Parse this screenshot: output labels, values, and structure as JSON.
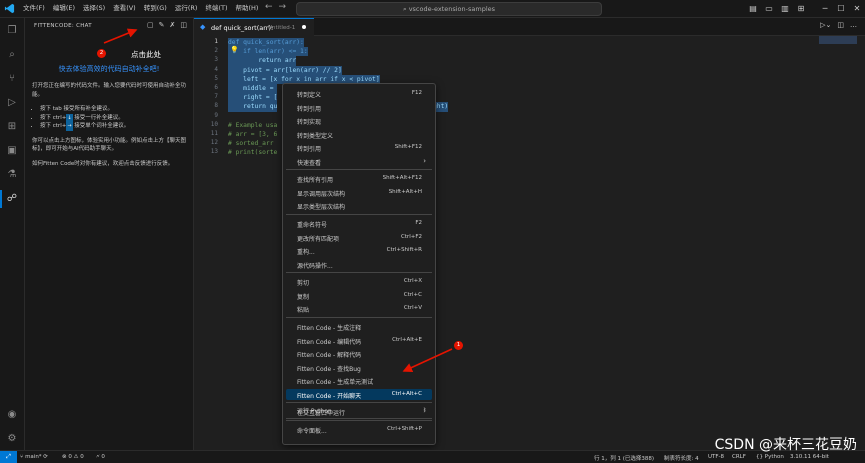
{
  "titlebar": {
    "menu": [
      "文件(F)",
      "编辑(E)",
      "选择(S)",
      "查看(V)",
      "转到(G)",
      "运行(R)",
      "终端(T)",
      "帮助(H)"
    ],
    "search": "vscode-extension-samples"
  },
  "sidebar": {
    "title": "FITTENCODE: CHAT",
    "callout": "点击此处",
    "promo": "快去体验高效的代码自动补全吧!",
    "intro": "打开您正在编写的代码文件。输入您要代码时可使用自动补全功能。",
    "tips": [
      "按下 tab 接受所有补全建议。",
      "按下 ctrl+",
      "接受一行补全建议。",
      "按下 ctrl+",
      "接受单个词补全建议。"
    ],
    "para2": "你可以点击上方图标，体验实用小功能。例如点击上方【聊天图标】，即可开始与AI代码助手聊天。",
    "para3": "如何Fitten Code时对你有建议，欢迎点击反馈进行反馈。"
  },
  "editor": {
    "tab_name": "def quick_sort(arr):",
    "tab_path": "Untitled-1",
    "code": {
      "l1": "def quick_sort(arr):",
      "l2": "    if len(arr) <= 1:",
      "l3": "        return arr",
      "l4": "    pivot = arr[len(arr) // 2]",
      "l5": "    left = [x for x in arr if x < pivot]",
      "l6": "    middle = ",
      "l7": "    right = [",
      "l8": "    return qu",
      "l8b": "ght)",
      "l10": "# Example usa",
      "l11": "# arr = [3, 6",
      "l12": "# sorted_arr ",
      "l13": "# print(sorte"
    }
  },
  "context_menu": {
    "items": [
      {
        "label": "转到定义",
        "shortcut": "F12"
      },
      {
        "label": "转到引用",
        "shortcut": ""
      },
      {
        "label": "转到实现",
        "shortcut": ""
      },
      {
        "label": "转到类型定义",
        "shortcut": ""
      },
      {
        "label": "转到引用",
        "shortcut": "Shift+F12"
      },
      {
        "label": "快速查看",
        "shortcut": ""
      },
      {
        "label": "查找所有引用",
        "shortcut": "Shift+Alt+F12"
      },
      {
        "label": "显示调用层次结构",
        "shortcut": "Shift+Alt+H"
      },
      {
        "label": "显示类型层次结构",
        "shortcut": ""
      },
      {
        "label": "重命名符号",
        "shortcut": "F2"
      },
      {
        "label": "更改所有匹配项",
        "shortcut": "Ctrl+F2"
      },
      {
        "label": "重构...",
        "shortcut": "Ctrl+Shift+R"
      },
      {
        "label": "源代码操作...",
        "shortcut": ""
      },
      {
        "label": "剪切",
        "shortcut": "Ctrl+X"
      },
      {
        "label": "复制",
        "shortcut": "Ctrl+C"
      },
      {
        "label": "粘贴",
        "shortcut": "Ctrl+V"
      },
      {
        "label": "Fitten Code - 生成注释",
        "shortcut": ""
      },
      {
        "label": "Fitten Code - 编辑代码",
        "shortcut": "Ctrl+Alt+E"
      },
      {
        "label": "Fitten Code - 解释代码",
        "shortcut": ""
      },
      {
        "label": "Fitten Code - 查找Bug",
        "shortcut": ""
      },
      {
        "label": "Fitten Code - 生成单元测试",
        "shortcut": ""
      },
      {
        "label": "Fitten Code - 开始聊天",
        "shortcut": "Ctrl+Alt+C"
      },
      {
        "label": "在交互窗口中运行",
        "shortcut": ""
      },
      {
        "label": "运行 Python",
        "shortcut": ""
      },
      {
        "label": "命令面板...",
        "shortcut": "Ctrl+Shift+P"
      }
    ]
  },
  "statusbar": {
    "branch": "main*",
    "problems": "⊗ 0 ⚠ 0",
    "ports": "🗲 0",
    "position": "行 1，列 1 (已选择388)",
    "spaces": "制表符长度: 4",
    "encoding": "UTF-8",
    "eol": "CRLF",
    "language": "Python",
    "interpreter": "3.10.11 64-bit"
  },
  "annotations": {
    "badge1": "1",
    "badge2": "2"
  },
  "watermark": "CSDN @来杯三花豆奶",
  "colors": {
    "accent": "#0078d4",
    "annotation_red": "#e51400",
    "promo_blue": "#3794ff"
  }
}
